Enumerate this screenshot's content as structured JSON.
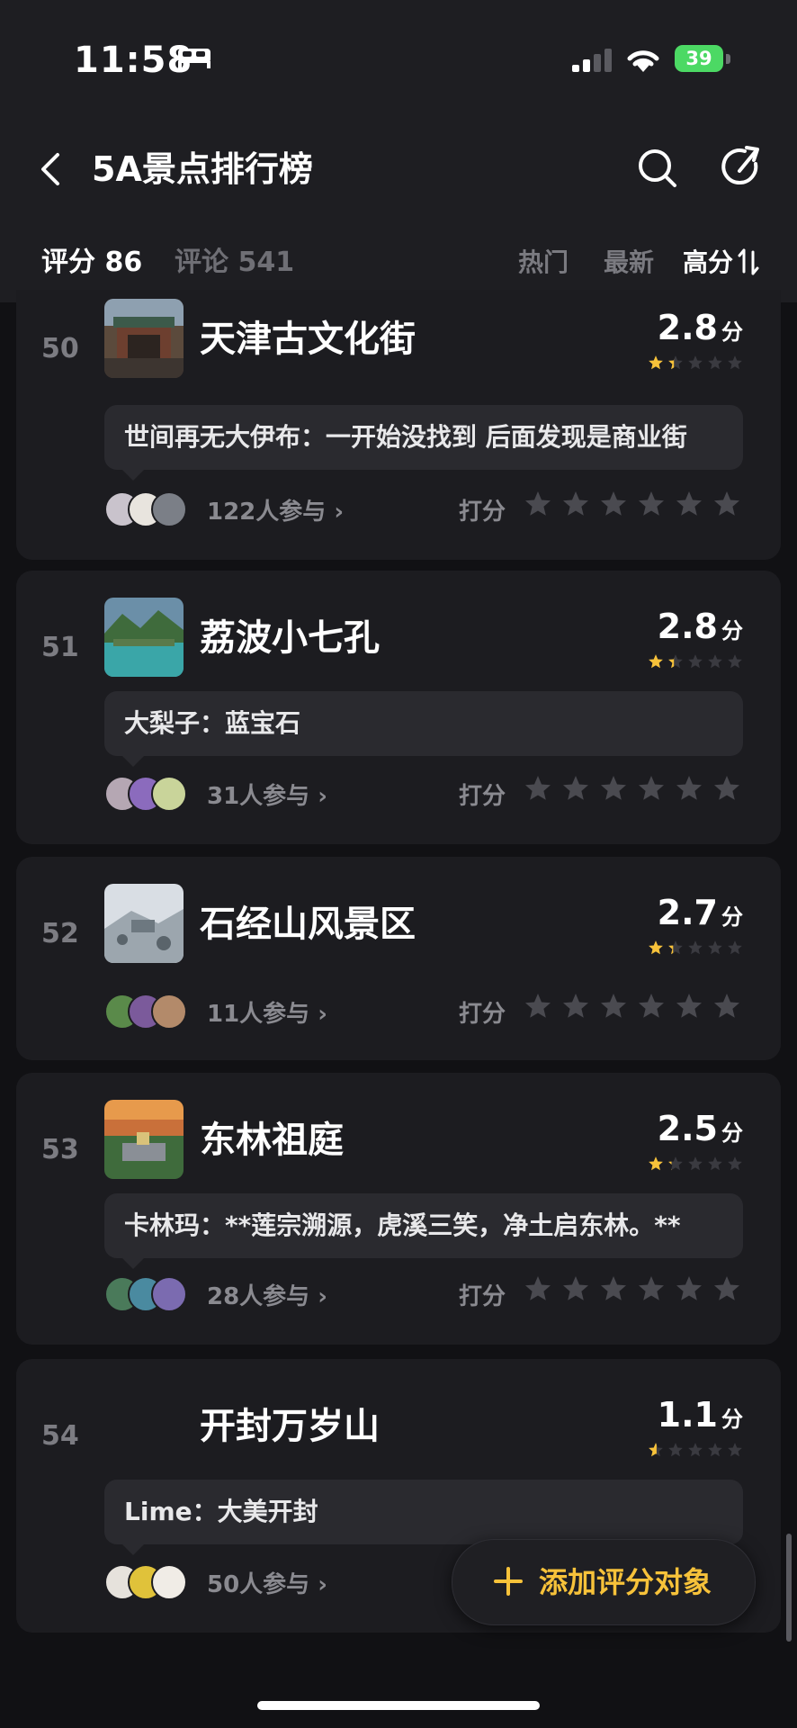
{
  "status": {
    "time": "11:58",
    "battery": "39"
  },
  "nav": {
    "title": "5A景点排行榜"
  },
  "tabs": {
    "score": "评分 86",
    "comments": "评论 541",
    "hot": "热门",
    "new": "最新",
    "high": "高分"
  },
  "rate_label": "打分",
  "items": [
    {
      "rank": "50",
      "name": "天津古文化街",
      "score": "2.8",
      "unit": "分",
      "stars": 1.4,
      "comment": "世间再无大伊布：一开始没找到 后面发现是商业街",
      "participants": "122人参与 ›"
    },
    {
      "rank": "51",
      "name": "荔波小七孔",
      "score": "2.8",
      "unit": "分",
      "stars": 1.4,
      "comment": "大梨子：蓝宝石",
      "participants": "31人参与 ›"
    },
    {
      "rank": "52",
      "name": "石经山风景区",
      "score": "2.7",
      "unit": "分",
      "stars": 1.35,
      "comment": "",
      "participants": "11人参与 ›"
    },
    {
      "rank": "53",
      "name": "东林祖庭",
      "score": "2.5",
      "unit": "分",
      "stars": 1.25,
      "comment": "卡林玛：**莲宗溯源，虎溪三笑，净土启东林。**",
      "participants": "28人参与 ›"
    },
    {
      "rank": "54",
      "name": "开封万岁山",
      "score": "1.1",
      "unit": "分",
      "stars": 0.55,
      "comment": "Lime：大美开封",
      "participants": "50人参与 ›"
    }
  ],
  "fab": {
    "label": "添加评分对象"
  },
  "colors": {
    "accent": "#f7c23a",
    "card": "#1c1c20",
    "bg": "#111114"
  }
}
